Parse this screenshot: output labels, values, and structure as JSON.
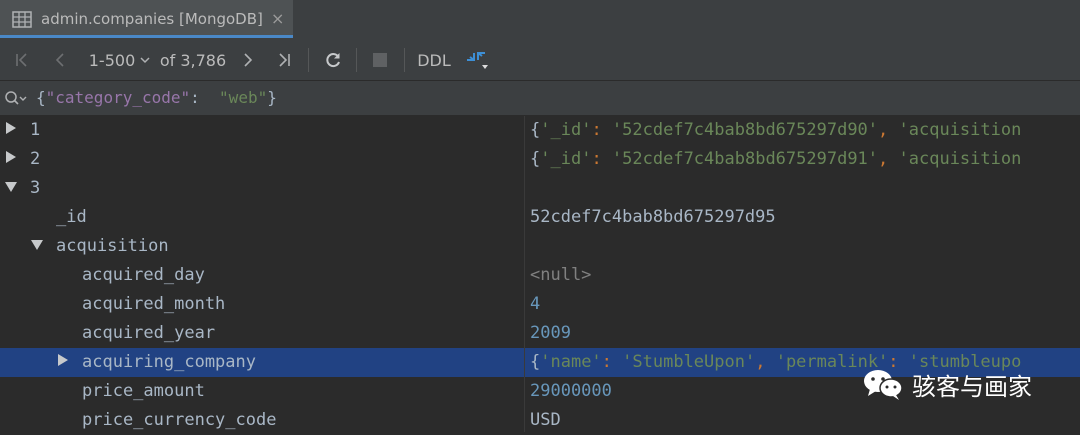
{
  "tab": {
    "title": "admin.companies [MongoDB]",
    "close": "×"
  },
  "toolbar": {
    "range": "1-500",
    "total": "of 3,786",
    "ddl": "DDL"
  },
  "filter": {
    "open": "{",
    "key": "\"category_code\"",
    "colon": ":  ",
    "value": "\"web\"",
    "close": "}"
  },
  "rows": [
    {
      "key": "1",
      "value_parts": [
        "{",
        "'_id'",
        ": ",
        "'52cdef7c4bab8bd675297d90'",
        ", ",
        "'acquisition"
      ]
    },
    {
      "key": "2",
      "value_parts": [
        "{",
        "'_id'",
        ": ",
        "'52cdef7c4bab8bd675297d91'",
        ", ",
        "'acquisition"
      ]
    },
    {
      "key": "3",
      "value": ""
    },
    {
      "key": "_id",
      "value": "52cdef7c4bab8bd675297d95"
    },
    {
      "key": "acquisition",
      "value": ""
    },
    {
      "key": "acquired_day",
      "value": "<null>"
    },
    {
      "key": "acquired_month",
      "value": "4"
    },
    {
      "key": "acquired_year",
      "value": "2009"
    },
    {
      "key": "acquiring_company",
      "value_parts": [
        "{",
        "'name'",
        ": ",
        "'StumbleUpon'",
        ", ",
        "'permalink'",
        ": ",
        "'stumbleupo"
      ]
    },
    {
      "key": "price_amount",
      "value": "29000000"
    },
    {
      "key": "price_currency_code",
      "value": "USD"
    }
  ],
  "watermark": {
    "text": "骇客与画家"
  },
  "colors": {
    "accent": "#4a88c7",
    "selection": "#214283",
    "background": "#2b2b2b"
  }
}
